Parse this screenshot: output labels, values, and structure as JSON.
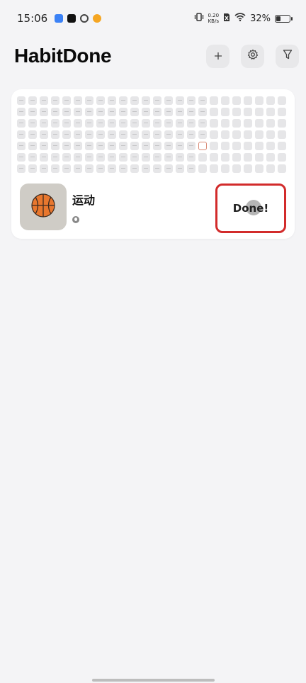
{
  "status_bar": {
    "time": "15:06",
    "net_speed_value": "0.20",
    "net_speed_unit": "KB/s",
    "battery_percent": "32%",
    "battery_level": 0.32,
    "app_icons": [
      "app-notification-icon",
      "tiktok-icon",
      "link-icon",
      "weibo-icon"
    ]
  },
  "header": {
    "title": "HabitDone",
    "actions": [
      "add-icon",
      "settings-icon",
      "filter-icon"
    ]
  },
  "habit": {
    "emoji": "🏀",
    "name": "运动",
    "done_label": "Done!",
    "grid": {
      "columns": 24,
      "rows": 7,
      "today": {
        "col": 16,
        "row": 4
      }
    }
  },
  "colors": {
    "background": "#f4f4f6",
    "card": "#ffffff",
    "cell": "#e6e6e8",
    "today_outline": "#d98a76",
    "highlight": "#d22b2b"
  }
}
